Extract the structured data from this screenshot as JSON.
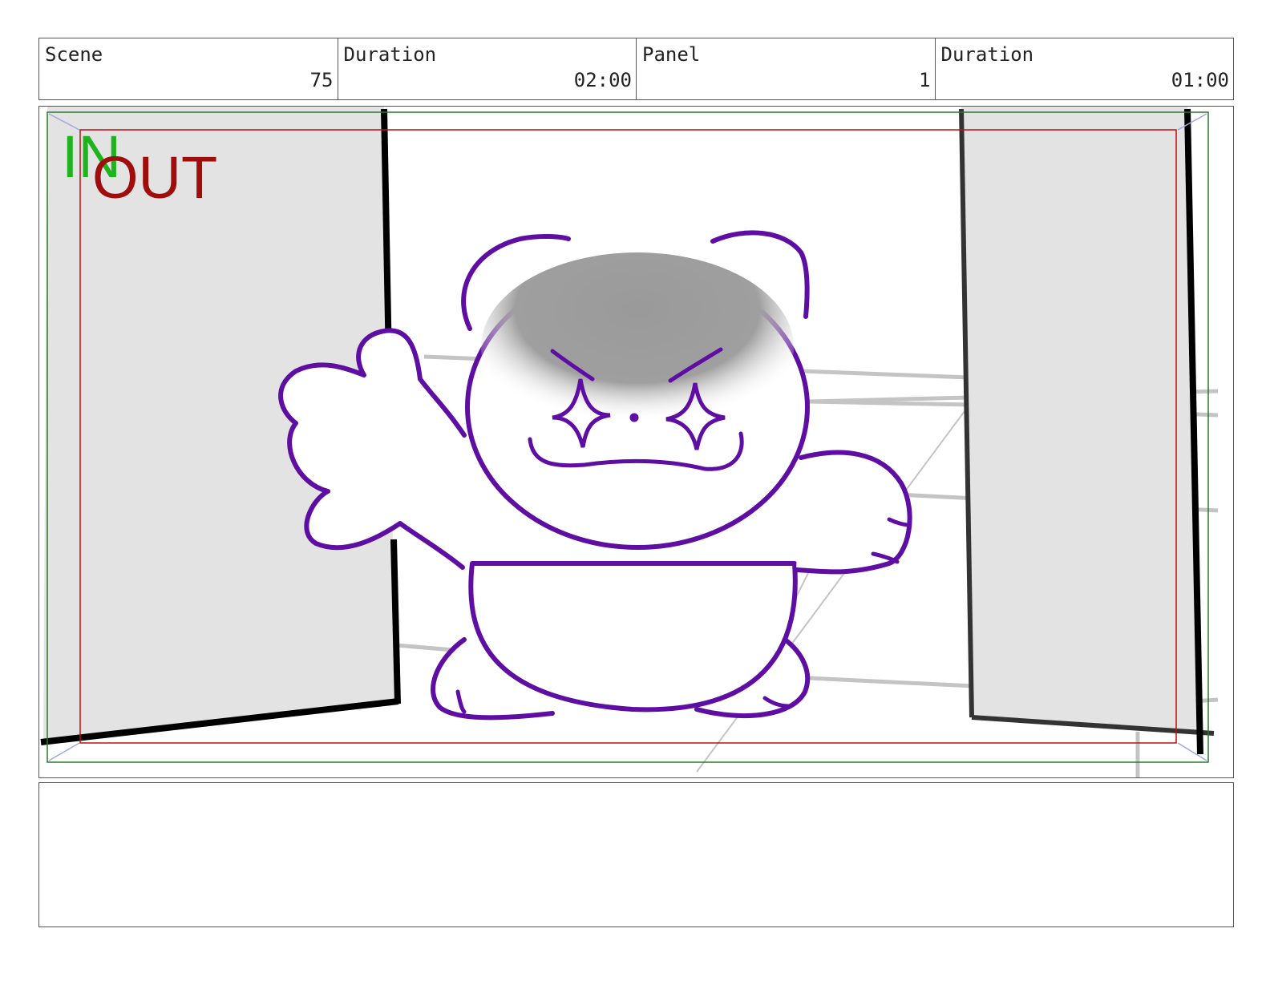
{
  "header": {
    "scene_label": "Scene",
    "scene_value": "75",
    "duration_label": "Duration",
    "duration_value": "02:00",
    "panel_label": "Panel",
    "panel_value": "1",
    "panel_duration_label": "Duration",
    "panel_duration_value": "01:00"
  },
  "frame": {
    "in_label": "IN",
    "out_label": "OUT",
    "in_color": "#1fb31f",
    "out_color": "#a00d0d",
    "character_line_color": "#5e0ea3"
  },
  "notes": {
    "text": ""
  }
}
